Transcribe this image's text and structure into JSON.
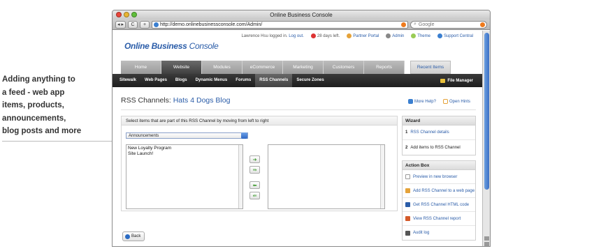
{
  "caption": {
    "lines": [
      "Adding anything to",
      "a feed - web app",
      "items, products,",
      "announcements,",
      "blog posts and more"
    ]
  },
  "browser": {
    "title": "Online Business Console",
    "url": "http://demo.onlinebusinessconsole.com/Admin/",
    "search_placeholder": "Google",
    "back_label": "◂ ▸",
    "reload_label": "C",
    "add_label": "+"
  },
  "topbar": {
    "user_text": "Lawrence Hsu logged in.",
    "logout": "Log out.",
    "days_left": "28 days left.",
    "partner_portal": "Partner Portal",
    "admin": "Admin",
    "theme": "Theme",
    "support": "Support Central"
  },
  "logo": {
    "bold": "Online Business",
    "light": "Console"
  },
  "tabs": [
    "Home",
    "Website",
    "Modules",
    "eCommerce",
    "Marketing",
    "Customers",
    "Reports"
  ],
  "recent_items": "Recent Items",
  "subnav": [
    "Sitewalk",
    "Web Pages",
    "Blogs",
    "Dynamic Menus",
    "Forums",
    "RSS Channels",
    "Secure Zones"
  ],
  "file_manager": "File Manager",
  "page": {
    "title_prefix": "RSS Channels:",
    "title_name": "Hats 4 Dogs Blog",
    "more_help": "More Help?",
    "open_hints": "Open Hints"
  },
  "main": {
    "instruction": "Select items that are part of this RSS Channel by moving from left to right",
    "selected_type": "Announcements",
    "left_items": [
      "New Loyalty Program",
      "Site Launch!"
    ],
    "back_label": "Back"
  },
  "wizard": {
    "title": "Wizard",
    "steps": [
      {
        "num": "1",
        "label": "RSS Channel details"
      },
      {
        "num": "2",
        "label": "Add items to RSS Channel"
      }
    ]
  },
  "actions": {
    "title": "Action Box",
    "items": [
      {
        "label": "Preview in new browser",
        "icon": "preview-icon",
        "color": "#ffffff"
      },
      {
        "label": "Add RSS Channel to a web page",
        "icon": "add-page-icon",
        "color": "#e5a33a"
      },
      {
        "label": "Get RSS Channel HTML code",
        "icon": "code-icon",
        "color": "#2a5ca8"
      },
      {
        "label": "View RSS Channel report",
        "icon": "report-icon",
        "color": "#d45a2a"
      },
      {
        "label": "Audit log",
        "icon": "audit-icon",
        "color": "#555555"
      }
    ]
  },
  "colors": {
    "brand_blue": "#2a5ca8",
    "active_tab": "#4a4a4a",
    "subnav_bg": "#222222"
  }
}
